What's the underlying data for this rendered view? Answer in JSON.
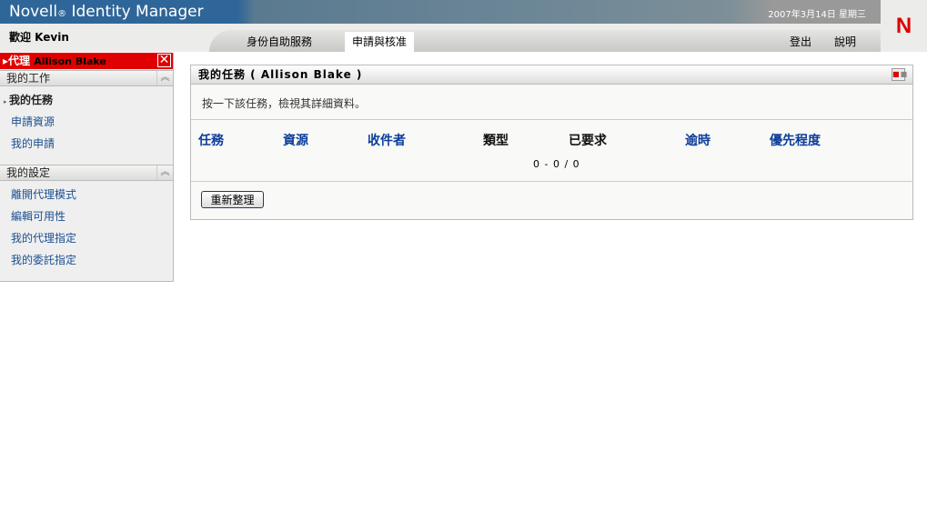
{
  "header": {
    "app_title": "Novell",
    "app_title_mark": "®",
    "app_title_rest": " Identity Manager",
    "date": "2007年3月14日 星期三",
    "logo": "N",
    "welcome": "歡迎 Kevin"
  },
  "tabs": [
    {
      "label": "身份自助服務",
      "active": false
    },
    {
      "label": "申請與核准",
      "active": true
    }
  ],
  "top_links": {
    "logout": "登出",
    "help": "說明"
  },
  "sidebar": {
    "proxy_label": "代理",
    "proxy_name": "Allison Blake",
    "close": "✕",
    "sections": [
      {
        "title": "我的工作",
        "items": [
          "我的任務",
          "申請資源",
          "我的申請"
        ]
      },
      {
        "title": "我的設定",
        "items": [
          "離開代理模式",
          "編輯可用性",
          "我的代理指定",
          "我的委託指定"
        ]
      }
    ]
  },
  "panel": {
    "title": "我的任務 ( Allison Blake )",
    "description": "按一下該任務，檢視其詳細資料。",
    "columns": [
      "任務",
      "資源",
      "收件者",
      "類型",
      "已要求",
      "逾時",
      "優先程度"
    ],
    "count": "0 - 0 / 0",
    "refresh_label": "重新整理"
  }
}
